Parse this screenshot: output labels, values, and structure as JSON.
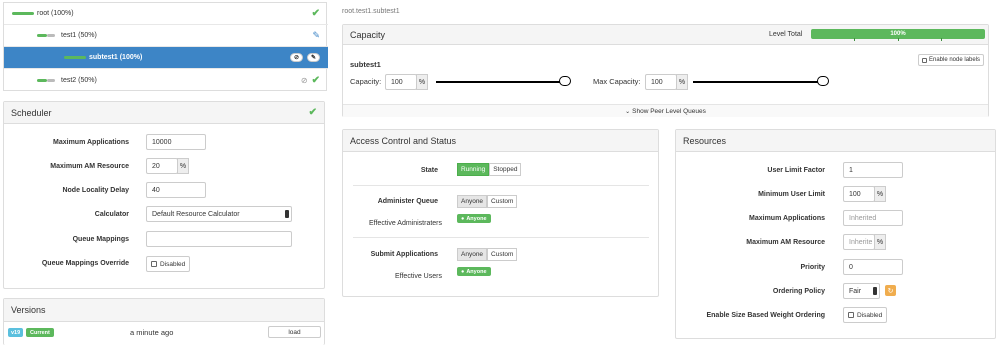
{
  "tree": {
    "root": {
      "label": "root (100%)"
    },
    "test1": {
      "label": "test1 (50%)"
    },
    "subtest1": {
      "label": "subtest1 (100%)"
    },
    "test2": {
      "label": "test2 (50%)"
    }
  },
  "scheduler": {
    "title": "Scheduler",
    "max_apps_label": "Maximum Applications",
    "max_apps_value": "10000",
    "max_am_label": "Maximum AM Resource",
    "max_am_value": "20",
    "percent": "%",
    "node_locality_label": "Node Locality Delay",
    "node_locality_value": "40",
    "calculator_label": "Calculator",
    "calculator_value": "Default Resource Calculator",
    "queue_mappings_label": "Queue Mappings",
    "queue_mappings_value": "",
    "override_label": "Queue Mappings Override",
    "override_value": "Disabled"
  },
  "versions": {
    "title": "Versions",
    "tag": "v19",
    "current": "Current",
    "time": "a minute ago",
    "load_label": "load"
  },
  "breadcrumb": "root.test1.subtest1",
  "capacity": {
    "title": "Capacity",
    "level_total_label": "Level Total",
    "level_total_value": "100%",
    "level_total_fraction": 1.0,
    "queue_name": "subtest1",
    "enable_node_labels": "Enable node labels",
    "capacity_label": "Capacity:",
    "capacity_value": "100",
    "capacity_fraction": 1.0,
    "max_capacity_label": "Max Capacity:",
    "max_capacity_value": "100",
    "max_capacity_fraction": 1.0,
    "percent": "%",
    "show_peer": "Show Peer Level Queues"
  },
  "access": {
    "title": "Access Control and Status",
    "state_label": "State",
    "running": "Running",
    "stopped": "Stopped",
    "admin_label": "Administer Queue",
    "anyone": "Anyone",
    "custom": "Custom",
    "effective_admins_label": "Effective Administraters",
    "anyone_badge": "Anyone",
    "submit_label": "Submit Applications",
    "effective_users_label": "Effective Users"
  },
  "resources": {
    "title": "Resources",
    "user_limit_factor_label": "User Limit Factor",
    "user_limit_factor_value": "1",
    "min_user_limit_label": "Minimum User Limit",
    "min_user_limit_value": "100",
    "max_apps_label": "Maximum Applications",
    "max_apps_placeholder": "Inherited",
    "max_am_label": "Maximum AM Resource",
    "max_am_placeholder": "Inherite",
    "percent": "%",
    "priority_label": "Priority",
    "priority_value": "0",
    "ordering_label": "Ordering Policy",
    "ordering_value": "Fair",
    "size_weight_label": "Enable Size Based Weight Ordering",
    "size_weight_value": "Disabled"
  },
  "colors": {
    "selected_row": "#3d85c6",
    "green": "#5cb85c",
    "orange": "#f0ad4e",
    "info": "#5bc0de"
  }
}
